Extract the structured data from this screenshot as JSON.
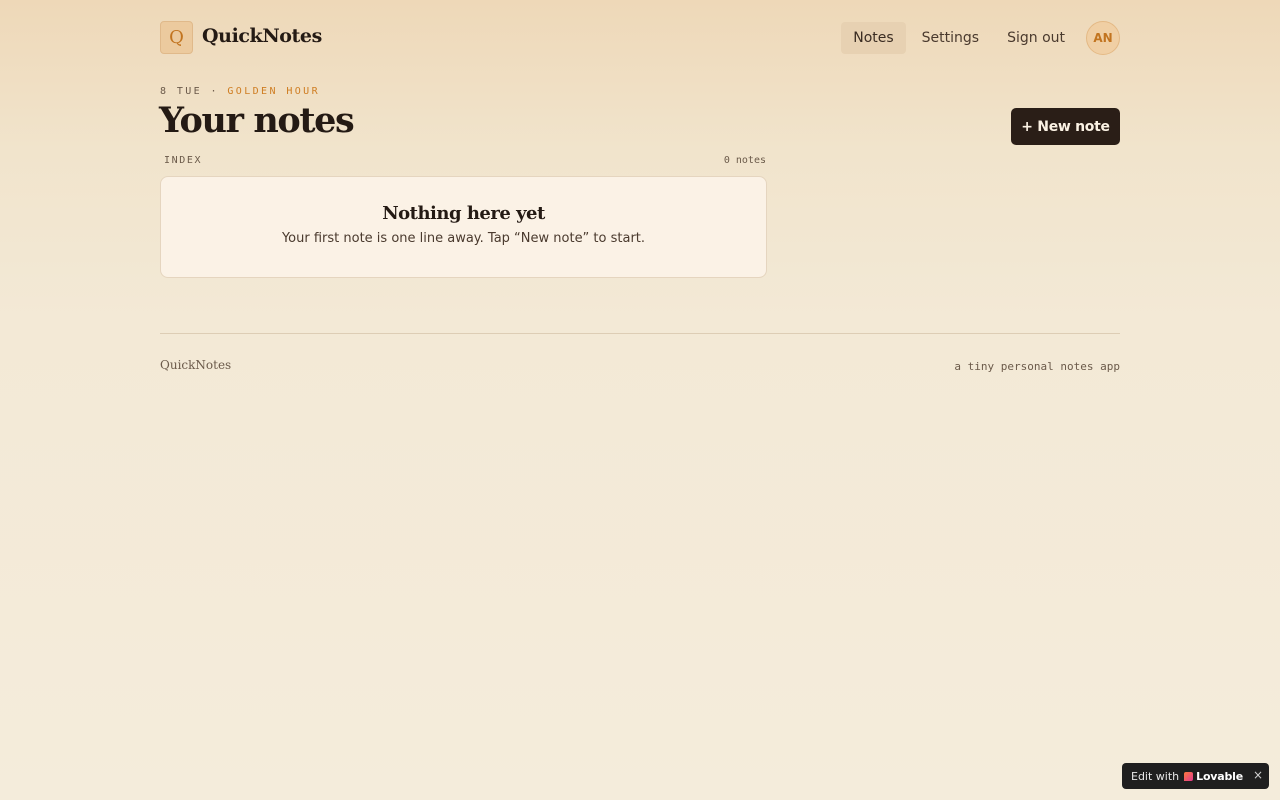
{
  "header": {
    "logo_letter": "Q",
    "brand": "QuickNotes",
    "nav": [
      {
        "label": "Notes",
        "active": true
      },
      {
        "label": "Settings",
        "active": false
      },
      {
        "label": "Sign out",
        "active": false
      }
    ],
    "avatar_initials": "AN"
  },
  "page": {
    "eyebrow_date": "8 TUE ·",
    "eyebrow_accent": "GOLDEN HOUR",
    "title": "Your notes",
    "new_note_label": "+ New note"
  },
  "index": {
    "label": "INDEX",
    "count": "0 notes",
    "empty_title": "Nothing here yet",
    "empty_subtitle": "Your first note is one line away. Tap “New note” to start."
  },
  "footer": {
    "brand": "QuickNotes",
    "tagline": "a tiny personal notes app"
  },
  "badge": {
    "prefix": "Edit with",
    "brand": "Lovable",
    "close": "×"
  },
  "colors": {
    "accent": "#cf7d22",
    "ink": "#241a14",
    "button_bg": "#2a1e17",
    "card_bg": "#fbf2e6"
  }
}
